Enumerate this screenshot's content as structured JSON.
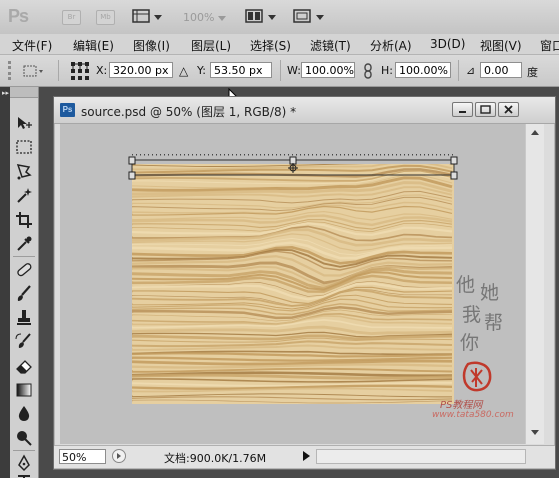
{
  "app": {
    "logo": "Ps",
    "bridge_badge": "Br",
    "minibridge_badge": "Mb",
    "zoom_label": "100%"
  },
  "menu": [
    "文件(F)",
    "编辑(E)",
    "图像(I)",
    "图层(L)",
    "选择(S)",
    "滤镜(T)",
    "分析(A)",
    "3D(D)",
    "视图(V)",
    "窗口"
  ],
  "options": {
    "x_label": "X:",
    "x_value": "320.00 px",
    "y_label": "Y:",
    "y_value": "53.50 px",
    "w_label": "W:",
    "w_value": "100.00%",
    "h_label": "H:",
    "h_value": "100.00%",
    "rotate_value": "0.00",
    "rotate_unit": "度"
  },
  "document": {
    "title": "source.psd @ 50% (图层 1, RGB/8) *",
    "ps_badge": "Ps",
    "zoom_field": "50%",
    "doc_info": "文档:900.0K/1.76M"
  },
  "tools": [
    "move-tool",
    "marquee-tool",
    "lasso-tool",
    "quick-select-tool",
    "crop-tool",
    "eyedropper-tool",
    "healing-brush-tool",
    "brush-tool",
    "clone-stamp-tool",
    "history-brush-tool",
    "eraser-tool",
    "gradient-tool",
    "blur-tool",
    "dodge-tool",
    "pen-tool",
    "type-tool"
  ],
  "watermark": {
    "chars": [
      "他",
      "她",
      "我",
      "帮",
      "你"
    ],
    "site_line1": "PS教程网",
    "site_line2": "www.tata580.com"
  },
  "colors": {
    "wood_light": "#e6cfa0",
    "wood_dark": "#b08a4e",
    "canvas_bg": "#bfbfbf",
    "workspace_bg": "#4a4a4a",
    "seal_red": "#c0392b"
  }
}
